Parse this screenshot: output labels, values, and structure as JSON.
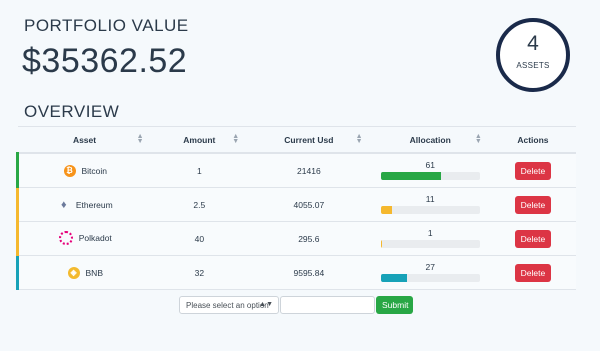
{
  "header": {
    "title": "PORTFOLIO VALUE",
    "value": "$35362.52",
    "asset_count": "4",
    "asset_count_label": "ASSETS"
  },
  "overview": {
    "title": "OVERVIEW",
    "columns": [
      "Asset",
      "Amount",
      "Current Usd",
      "Allocation",
      "Actions"
    ],
    "rows": [
      {
        "asset": "Bitcoin",
        "icon": "bitcoin-icon",
        "amount": "1",
        "usd": "21416",
        "allocation": "61",
        "allocation_fraction": 0.61,
        "color": "#28a745",
        "border_color": "#28a745",
        "action": "Delete"
      },
      {
        "asset": "Ethereum",
        "icon": "ethereum-icon",
        "amount": "2.5",
        "usd": "4055.07",
        "allocation": "11",
        "allocation_fraction": 0.11,
        "color": "#f5b82e",
        "border_color": "#f5b82e",
        "action": "Delete"
      },
      {
        "asset": "Polkadot",
        "icon": "polkadot-icon",
        "amount": "40",
        "usd": "295.6",
        "allocation": "1",
        "allocation_fraction": 0.01,
        "color": "#f5b82e",
        "border_color": "#f5b82e",
        "action": "Delete"
      },
      {
        "asset": "BNB",
        "icon": "bnb-icon",
        "amount": "32",
        "usd": "9595.84",
        "allocation": "27",
        "allocation_fraction": 0.27,
        "color": "#17a2b8",
        "border_color": "#17a2b8",
        "action": "Delete"
      }
    ]
  },
  "form": {
    "select_placeholder": "Please select an option",
    "input_value": "",
    "submit_label": "Submit"
  }
}
